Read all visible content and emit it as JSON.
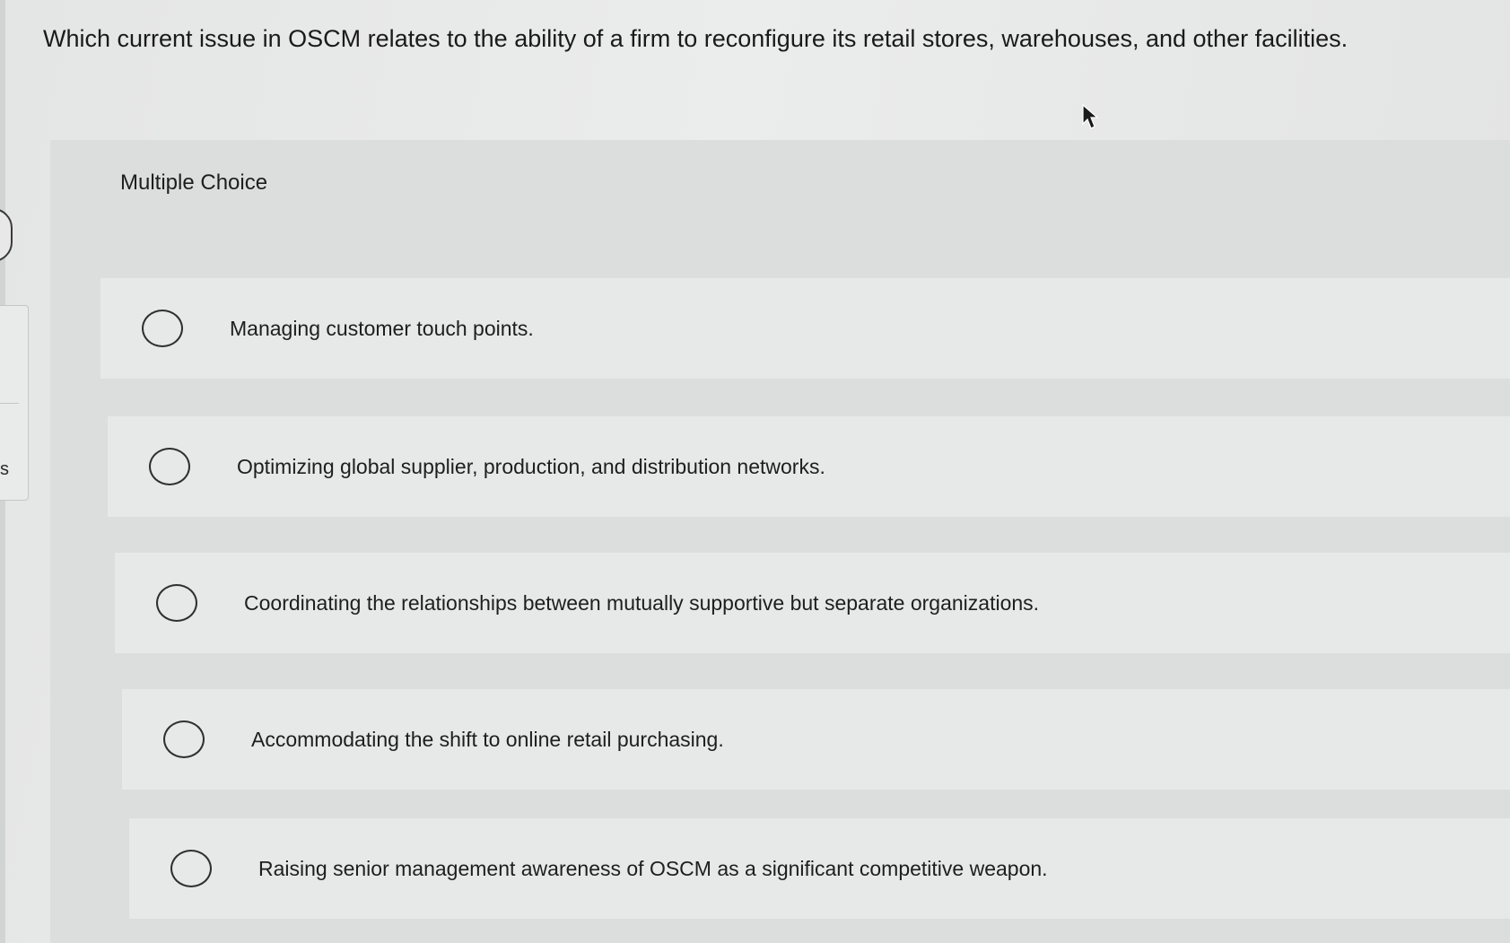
{
  "question": {
    "text": "Which current issue in OSCM relates to the ability of a firm to reconfigure its retail stores, warehouses, and other facilities."
  },
  "left_sidebar": {
    "letter": "s"
  },
  "multiple_choice": {
    "label": "Multiple Choice",
    "selected_index": null,
    "options": [
      {
        "label": "Managing customer touch points."
      },
      {
        "label": "Optimizing global supplier, production, and distribution networks."
      },
      {
        "label": "Coordinating the relationships between mutually supportive but separate organizations."
      },
      {
        "label": "Accommodating the shift to online retail purchasing."
      },
      {
        "label": "Raising senior management awareness of OSCM as a significant competitive weapon."
      }
    ]
  },
  "icons": {
    "cursor": "arrow-cursor-icon",
    "radio": "radio-unchecked-icon"
  }
}
